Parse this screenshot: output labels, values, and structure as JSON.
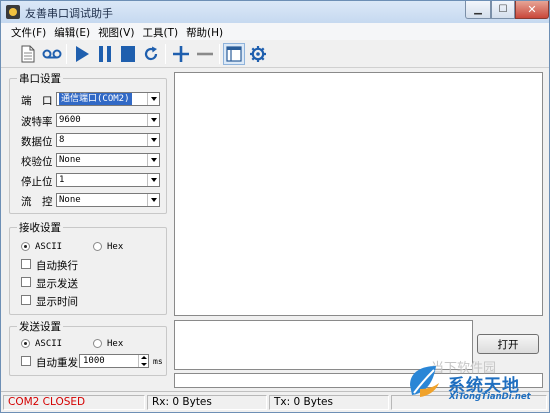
{
  "window": {
    "title": "友善串口调试助手"
  },
  "menu": [
    {
      "label": "文件(F)"
    },
    {
      "label": "编辑(E)"
    },
    {
      "label": "视图(V)"
    },
    {
      "label": "工具(T)"
    },
    {
      "label": "帮助(H)"
    }
  ],
  "serial_settings": {
    "title": "串口设置",
    "port": {
      "label": "端　口",
      "value": "通信端口(COM2)"
    },
    "baud": {
      "label": "波特率",
      "value": "9600"
    },
    "data_bits": {
      "label": "数据位",
      "value": "8"
    },
    "parity": {
      "label": "校验位",
      "value": "None"
    },
    "stop_bits": {
      "label": "停止位",
      "value": "1"
    },
    "flow": {
      "label": "流　控",
      "value": "None"
    }
  },
  "receive_settings": {
    "title": "接收设置",
    "ascii": "ASCII",
    "hex": "Hex",
    "selected": "ASCII",
    "auto_newline": "自动换行",
    "show_send": "显示发送",
    "show_time": "显示时间"
  },
  "send_settings": {
    "title": "发送设置",
    "ascii": "ASCII",
    "hex": "Hex",
    "selected": "ASCII",
    "auto_resend": "自动重发",
    "interval": "1000",
    "unit": "ms"
  },
  "open_button": "打开",
  "status": {
    "port": "COM2 CLOSED",
    "rx": "Rx: 0 Bytes",
    "tx": "Tx: 0 Bytes"
  },
  "watermark": {
    "title": "系统天地",
    "subtitle": "XiTongTianDi.net",
    "faint": "当下软件园"
  },
  "colors": {
    "play": "#1f5fae",
    "status_closed": "#d40000",
    "watermark": "#1f6fc0"
  }
}
